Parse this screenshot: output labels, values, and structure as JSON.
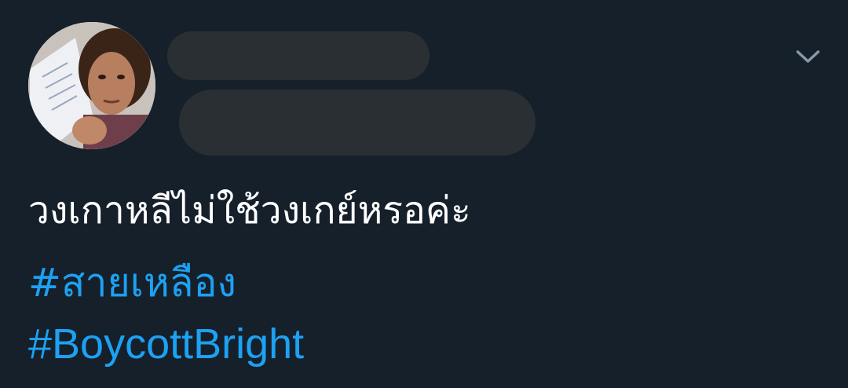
{
  "tweet": {
    "avatar_icon": "profile-photo",
    "menu_icon": "chevron-down-icon",
    "text": "วงเกาหลีไม่ใช้วงเกย์หรอค่ะ",
    "hashtags": [
      "#สายเหลือง",
      "#BoycottBright"
    ]
  },
  "colors": {
    "background": "#15202b",
    "text": "#ffffff",
    "link": "#1da1f2",
    "redaction": "#2a2f34",
    "icon": "#8899a6"
  }
}
